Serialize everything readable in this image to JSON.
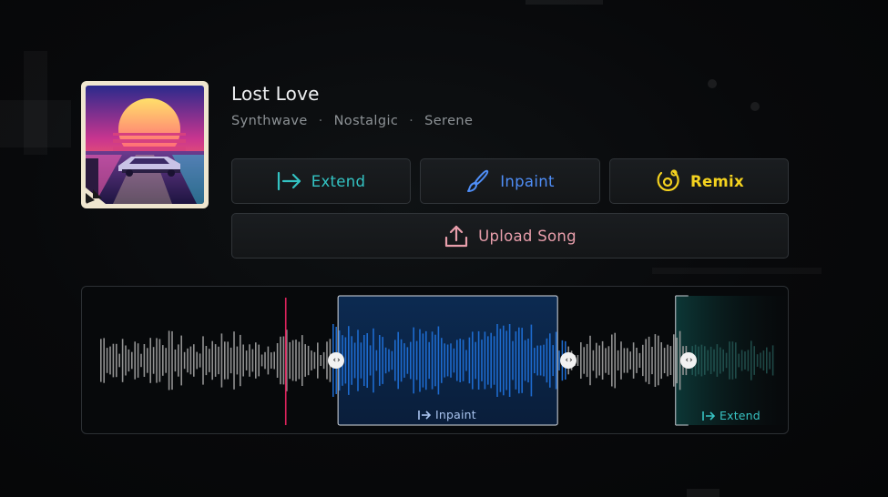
{
  "song": {
    "title": "Lost Love",
    "tags": [
      "Synthwave",
      "Nostalgic",
      "Serene"
    ],
    "tag_separator": "·",
    "cover_icon": "synthwave-sunset-car-artwork"
  },
  "actions": {
    "extend_label": "Extend",
    "inpaint_label": "Inpaint",
    "remix_label": "Remix",
    "upload_label": "Upload Song"
  },
  "waveform": {
    "inpaint_label": "Inpaint",
    "extend_label": "Extend",
    "handle_glyph": "‹›",
    "playhead_fraction": 0.272,
    "inpaint_region": [
      0.343,
      0.694
    ],
    "extend_start": 0.875
  },
  "colors": {
    "extend": "#33c3c3",
    "inpaint": "#4f8ef7",
    "remix": "#f4d21f",
    "upload": "#e89eab",
    "playhead": "#e0245e",
    "wave_base": "#9a9a9a"
  }
}
